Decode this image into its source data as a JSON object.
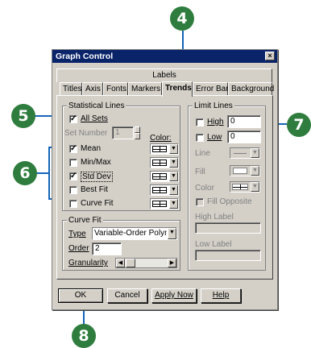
{
  "callouts": {
    "c4": "4",
    "c5": "5",
    "c6": "6",
    "c7": "7",
    "c8": "8"
  },
  "window": {
    "title": "Graph Control",
    "close_glyph": "×"
  },
  "tabs": {
    "labels_row": "Labels",
    "row": [
      "Titles",
      "Axis",
      "Fonts",
      "Markers",
      "Trends",
      "Error Bar",
      "Background"
    ],
    "active": "Trends"
  },
  "stat": {
    "group_label": "Statistical Lines",
    "all_sets": {
      "label": "All Sets",
      "checked": true
    },
    "set_number": {
      "label": "Set Number",
      "value": "1"
    },
    "color_label": "Color:",
    "items": [
      {
        "label": "Mean",
        "checked": true
      },
      {
        "label": "Min/Max",
        "checked": false
      },
      {
        "label": "Std Dev",
        "checked": true
      },
      {
        "label": "Best Fit",
        "checked": false
      },
      {
        "label": "Curve Fit",
        "checked": false
      }
    ]
  },
  "curve": {
    "group_label": "Curve Fit",
    "type_label": "Type",
    "type_value": "Variable-Order Polynomial",
    "order_label": "Order",
    "order_value": "2",
    "granularity_label": "Granularity"
  },
  "limit": {
    "group_label": "Limit Lines",
    "high": {
      "label": "High",
      "value": "0"
    },
    "low": {
      "label": "Low",
      "value": "0"
    },
    "line_label": "Line",
    "fill_label": "Fill",
    "color_label": "Color",
    "fill_opposite": "Fill Opposite",
    "high_label": "High Label",
    "low_label": "Low Label"
  },
  "buttons": {
    "ok": "OK",
    "cancel": "Cancel",
    "apply": "Apply Now",
    "help": "Help"
  },
  "colors": {
    "callout": "#2f7d3e",
    "leader": "#1565b8",
    "titlebar": "#0a246a",
    "dialog": "#d4d0c8"
  }
}
